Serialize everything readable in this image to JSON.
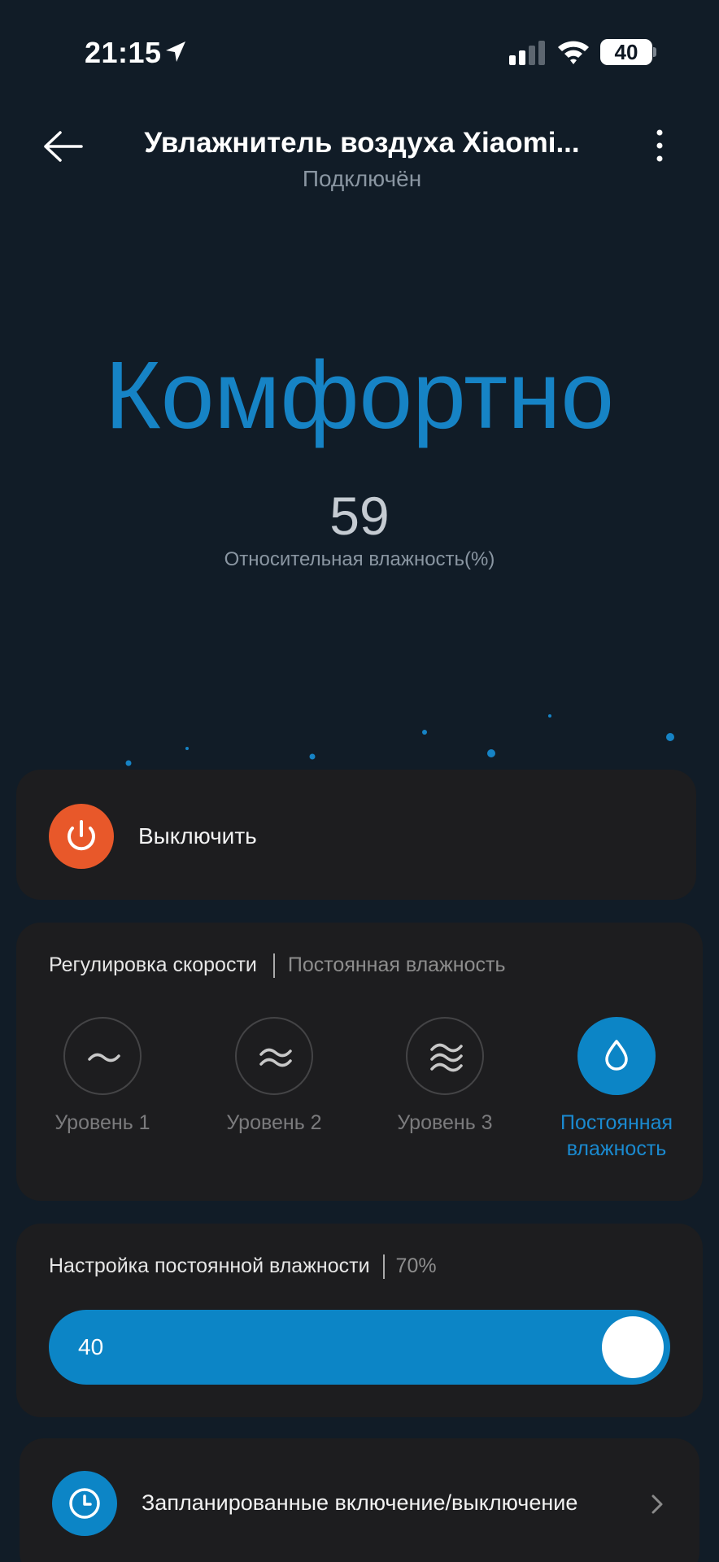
{
  "status_bar": {
    "time": "21:15",
    "battery": "40"
  },
  "header": {
    "title": "Увлажнитель воздуха Xiaomi...",
    "subtitle": "Подключён"
  },
  "reading": {
    "state": "Комфортно",
    "humidity_value": "59",
    "humidity_label": "Относительная влажность(%)"
  },
  "power": {
    "label": "Выключить"
  },
  "speed": {
    "title": "Регулировка скорости",
    "current": "Постоянная влажность",
    "levels": [
      {
        "label": "Уровень 1",
        "icon": "wave-1-icon",
        "active": false
      },
      {
        "label": "Уровень 2",
        "icon": "wave-2-icon",
        "active": false
      },
      {
        "label": "Уровень 3",
        "icon": "wave-3-icon",
        "active": false
      },
      {
        "label": "Постоянная влажность",
        "icon": "droplet-icon",
        "active": true
      }
    ]
  },
  "humidity_setting": {
    "title": "Настройка постоянной влажности",
    "target": "70%",
    "slider_value": "40"
  },
  "schedule": {
    "label": "Запланированные включение/выключение"
  },
  "colors": {
    "background": "#111c27",
    "card": "#1d1d1f",
    "accent": "#0c85c6",
    "power": "#e8582a"
  }
}
